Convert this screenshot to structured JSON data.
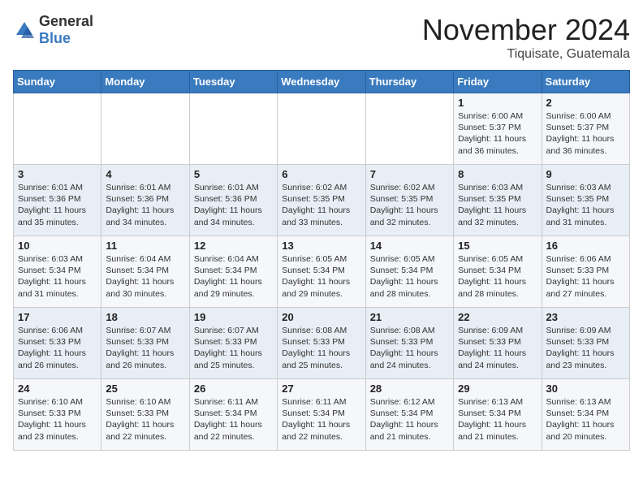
{
  "logo": {
    "general": "General",
    "blue": "Blue"
  },
  "header": {
    "month_year": "November 2024",
    "location": "Tiquisate, Guatemala"
  },
  "weekdays": [
    "Sunday",
    "Monday",
    "Tuesday",
    "Wednesday",
    "Thursday",
    "Friday",
    "Saturday"
  ],
  "weeks": [
    [
      {
        "day": "",
        "info": ""
      },
      {
        "day": "",
        "info": ""
      },
      {
        "day": "",
        "info": ""
      },
      {
        "day": "",
        "info": ""
      },
      {
        "day": "",
        "info": ""
      },
      {
        "day": "1",
        "info": "Sunrise: 6:00 AM\nSunset: 5:37 PM\nDaylight: 11 hours\nand 36 minutes."
      },
      {
        "day": "2",
        "info": "Sunrise: 6:00 AM\nSunset: 5:37 PM\nDaylight: 11 hours\nand 36 minutes."
      }
    ],
    [
      {
        "day": "3",
        "info": "Sunrise: 6:01 AM\nSunset: 5:36 PM\nDaylight: 11 hours\nand 35 minutes."
      },
      {
        "day": "4",
        "info": "Sunrise: 6:01 AM\nSunset: 5:36 PM\nDaylight: 11 hours\nand 34 minutes."
      },
      {
        "day": "5",
        "info": "Sunrise: 6:01 AM\nSunset: 5:36 PM\nDaylight: 11 hours\nand 34 minutes."
      },
      {
        "day": "6",
        "info": "Sunrise: 6:02 AM\nSunset: 5:35 PM\nDaylight: 11 hours\nand 33 minutes."
      },
      {
        "day": "7",
        "info": "Sunrise: 6:02 AM\nSunset: 5:35 PM\nDaylight: 11 hours\nand 32 minutes."
      },
      {
        "day": "8",
        "info": "Sunrise: 6:03 AM\nSunset: 5:35 PM\nDaylight: 11 hours\nand 32 minutes."
      },
      {
        "day": "9",
        "info": "Sunrise: 6:03 AM\nSunset: 5:35 PM\nDaylight: 11 hours\nand 31 minutes."
      }
    ],
    [
      {
        "day": "10",
        "info": "Sunrise: 6:03 AM\nSunset: 5:34 PM\nDaylight: 11 hours\nand 31 minutes."
      },
      {
        "day": "11",
        "info": "Sunrise: 6:04 AM\nSunset: 5:34 PM\nDaylight: 11 hours\nand 30 minutes."
      },
      {
        "day": "12",
        "info": "Sunrise: 6:04 AM\nSunset: 5:34 PM\nDaylight: 11 hours\nand 29 minutes."
      },
      {
        "day": "13",
        "info": "Sunrise: 6:05 AM\nSunset: 5:34 PM\nDaylight: 11 hours\nand 29 minutes."
      },
      {
        "day": "14",
        "info": "Sunrise: 6:05 AM\nSunset: 5:34 PM\nDaylight: 11 hours\nand 28 minutes."
      },
      {
        "day": "15",
        "info": "Sunrise: 6:05 AM\nSunset: 5:34 PM\nDaylight: 11 hours\nand 28 minutes."
      },
      {
        "day": "16",
        "info": "Sunrise: 6:06 AM\nSunset: 5:33 PM\nDaylight: 11 hours\nand 27 minutes."
      }
    ],
    [
      {
        "day": "17",
        "info": "Sunrise: 6:06 AM\nSunset: 5:33 PM\nDaylight: 11 hours\nand 26 minutes."
      },
      {
        "day": "18",
        "info": "Sunrise: 6:07 AM\nSunset: 5:33 PM\nDaylight: 11 hours\nand 26 minutes."
      },
      {
        "day": "19",
        "info": "Sunrise: 6:07 AM\nSunset: 5:33 PM\nDaylight: 11 hours\nand 25 minutes."
      },
      {
        "day": "20",
        "info": "Sunrise: 6:08 AM\nSunset: 5:33 PM\nDaylight: 11 hours\nand 25 minutes."
      },
      {
        "day": "21",
        "info": "Sunrise: 6:08 AM\nSunset: 5:33 PM\nDaylight: 11 hours\nand 24 minutes."
      },
      {
        "day": "22",
        "info": "Sunrise: 6:09 AM\nSunset: 5:33 PM\nDaylight: 11 hours\nand 24 minutes."
      },
      {
        "day": "23",
        "info": "Sunrise: 6:09 AM\nSunset: 5:33 PM\nDaylight: 11 hours\nand 23 minutes."
      }
    ],
    [
      {
        "day": "24",
        "info": "Sunrise: 6:10 AM\nSunset: 5:33 PM\nDaylight: 11 hours\nand 23 minutes."
      },
      {
        "day": "25",
        "info": "Sunrise: 6:10 AM\nSunset: 5:33 PM\nDaylight: 11 hours\nand 22 minutes."
      },
      {
        "day": "26",
        "info": "Sunrise: 6:11 AM\nSunset: 5:34 PM\nDaylight: 11 hours\nand 22 minutes."
      },
      {
        "day": "27",
        "info": "Sunrise: 6:11 AM\nSunset: 5:34 PM\nDaylight: 11 hours\nand 22 minutes."
      },
      {
        "day": "28",
        "info": "Sunrise: 6:12 AM\nSunset: 5:34 PM\nDaylight: 11 hours\nand 21 minutes."
      },
      {
        "day": "29",
        "info": "Sunrise: 6:13 AM\nSunset: 5:34 PM\nDaylight: 11 hours\nand 21 minutes."
      },
      {
        "day": "30",
        "info": "Sunrise: 6:13 AM\nSunset: 5:34 PM\nDaylight: 11 hours\nand 20 minutes."
      }
    ]
  ]
}
